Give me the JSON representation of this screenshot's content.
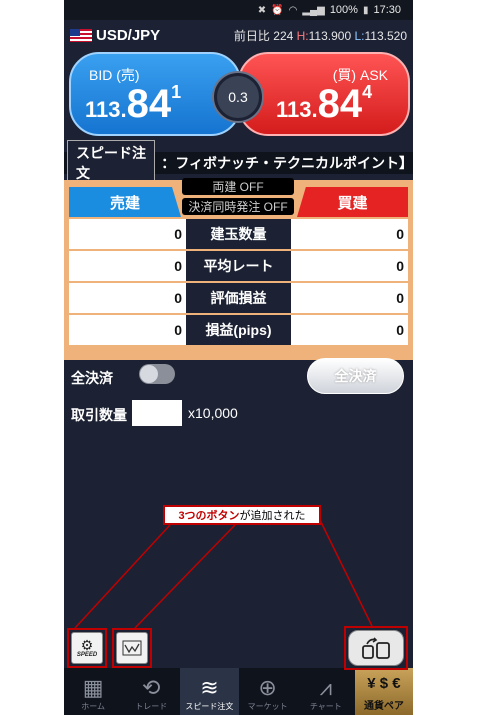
{
  "status_bar": {
    "battery": "100%",
    "time": "17:30"
  },
  "header": {
    "pair": "USD/JPY",
    "change_label": "前日比",
    "change_value": "224",
    "high_prefix": "H:",
    "high": "113.900",
    "low_prefix": "L:",
    "low": "113.520"
  },
  "quotes": {
    "bid_label": "BID (売)",
    "bid_big": "113.",
    "bid_mid": "84",
    "bid_small": "1",
    "ask_label": "(買) ASK",
    "ask_big": "113.",
    "ask_mid": "84",
    "ask_small": "4",
    "spread": "0.3"
  },
  "speed_order": {
    "label": "スピード注文",
    "strategy": "：フィボナッチ・テクニカルポイント】"
  },
  "panel": {
    "sell_label": "売建",
    "buy_label": "買建",
    "toggle1": "両建 OFF",
    "toggle2": "決済同時発注 OFF",
    "rows": [
      {
        "label": "建玉数量",
        "sell": "0",
        "buy": "0"
      },
      {
        "label": "平均レート",
        "sell": "0",
        "buy": "0"
      },
      {
        "label": "評価損益",
        "sell": "0",
        "buy": "0"
      },
      {
        "label": "損益(pips)",
        "sell": "0",
        "buy": "0"
      }
    ]
  },
  "close_all": {
    "label": "全決済",
    "button": "全決済"
  },
  "quantity": {
    "label": "取引数量",
    "value": "",
    "unit": "x10,000"
  },
  "annotation": {
    "highlight": "3つのボタン",
    "rest": "が追加された"
  },
  "float_buttons": {
    "speed_label": "SPEED"
  },
  "nav": [
    {
      "label": "ホーム",
      "icon": "grid-icon"
    },
    {
      "label": "トレード",
      "icon": "refresh-icon"
    },
    {
      "label": "スピード注文",
      "icon": "speed-icon"
    },
    {
      "label": "マーケット",
      "icon": "globe-icon"
    },
    {
      "label": "チャート",
      "icon": "chart-icon"
    },
    {
      "label": "通貨ペア",
      "icon": "currency-icon"
    }
  ],
  "colors": {
    "bid": "#1574d0",
    "ask": "#d41c1c",
    "annotation": "#c00000",
    "panel": "#efb27a"
  }
}
